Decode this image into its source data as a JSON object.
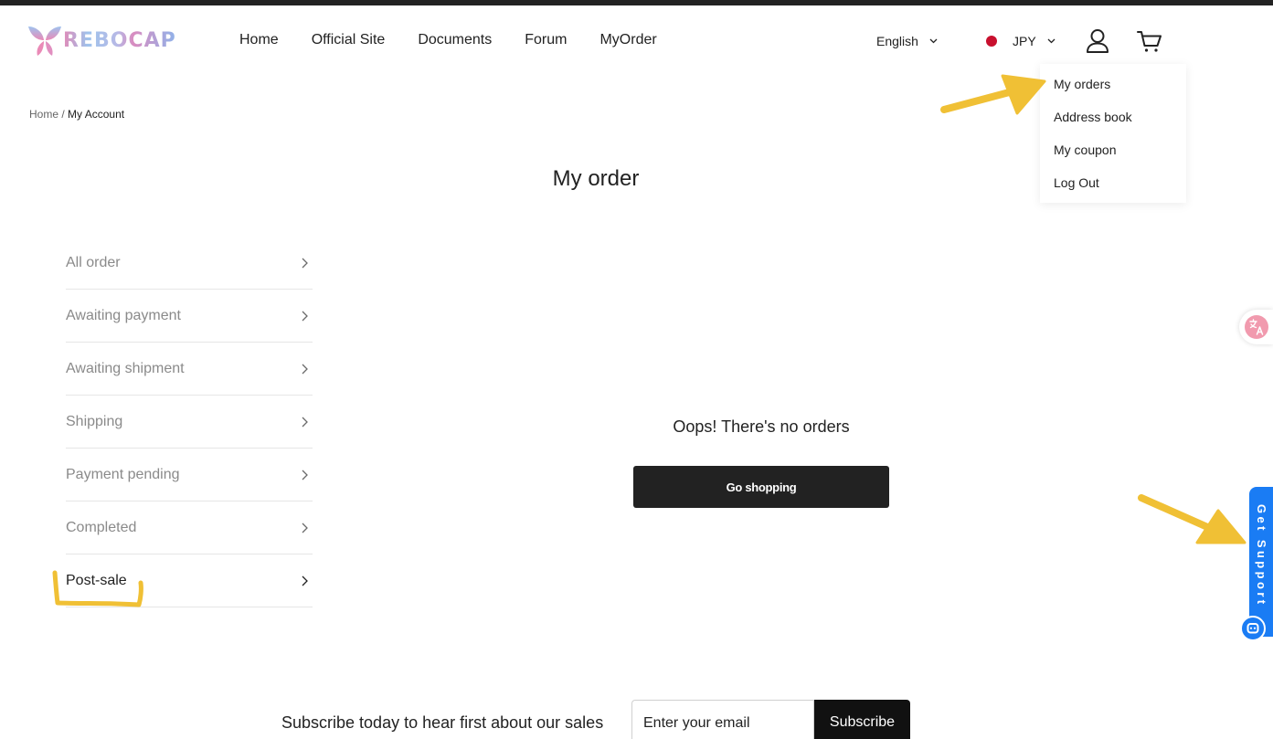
{
  "header": {
    "logo_text": "REBOCAP",
    "nav": [
      {
        "label": "Home"
      },
      {
        "label": "Official Site"
      },
      {
        "label": "Documents"
      },
      {
        "label": "Forum"
      },
      {
        "label": "MyOrder"
      }
    ],
    "language": "English",
    "currency": "JPY",
    "icons": {
      "language_toggle": "chevron-down-icon",
      "currency_flag": "japan-flag-icon",
      "account": "user-icon",
      "cart": "cart-icon"
    }
  },
  "account_menu": {
    "items": [
      {
        "label": "My orders"
      },
      {
        "label": "Address book"
      },
      {
        "label": "My coupon"
      },
      {
        "label": "Log Out"
      }
    ]
  },
  "breadcrumb": {
    "home": "Home",
    "separator": "/",
    "current": "My Account"
  },
  "page_title": "My order",
  "order_tabs": [
    {
      "label": "All order",
      "active": false
    },
    {
      "label": "Awaiting payment",
      "active": false
    },
    {
      "label": "Awaiting shipment",
      "active": false
    },
    {
      "label": "Shipping",
      "active": false
    },
    {
      "label": "Payment pending",
      "active": false
    },
    {
      "label": "Completed",
      "active": false
    },
    {
      "label": "Post-sale",
      "active": true
    }
  ],
  "empty_state": {
    "message": "Oops! There's no orders",
    "button_label": "Go shopping"
  },
  "floating": {
    "translate_icon": "translate-icon",
    "support_label": "Get Support",
    "chat_icon": "chat-icon"
  },
  "newsletter": {
    "text": "Subscribe today to hear first about our sales",
    "placeholder": "Enter your email",
    "button_label": "Subscribe"
  },
  "colors": {
    "support": "#1a7cf4",
    "annotation": "#f0c035",
    "flag": "#c8102e",
    "dark": "#222222"
  }
}
